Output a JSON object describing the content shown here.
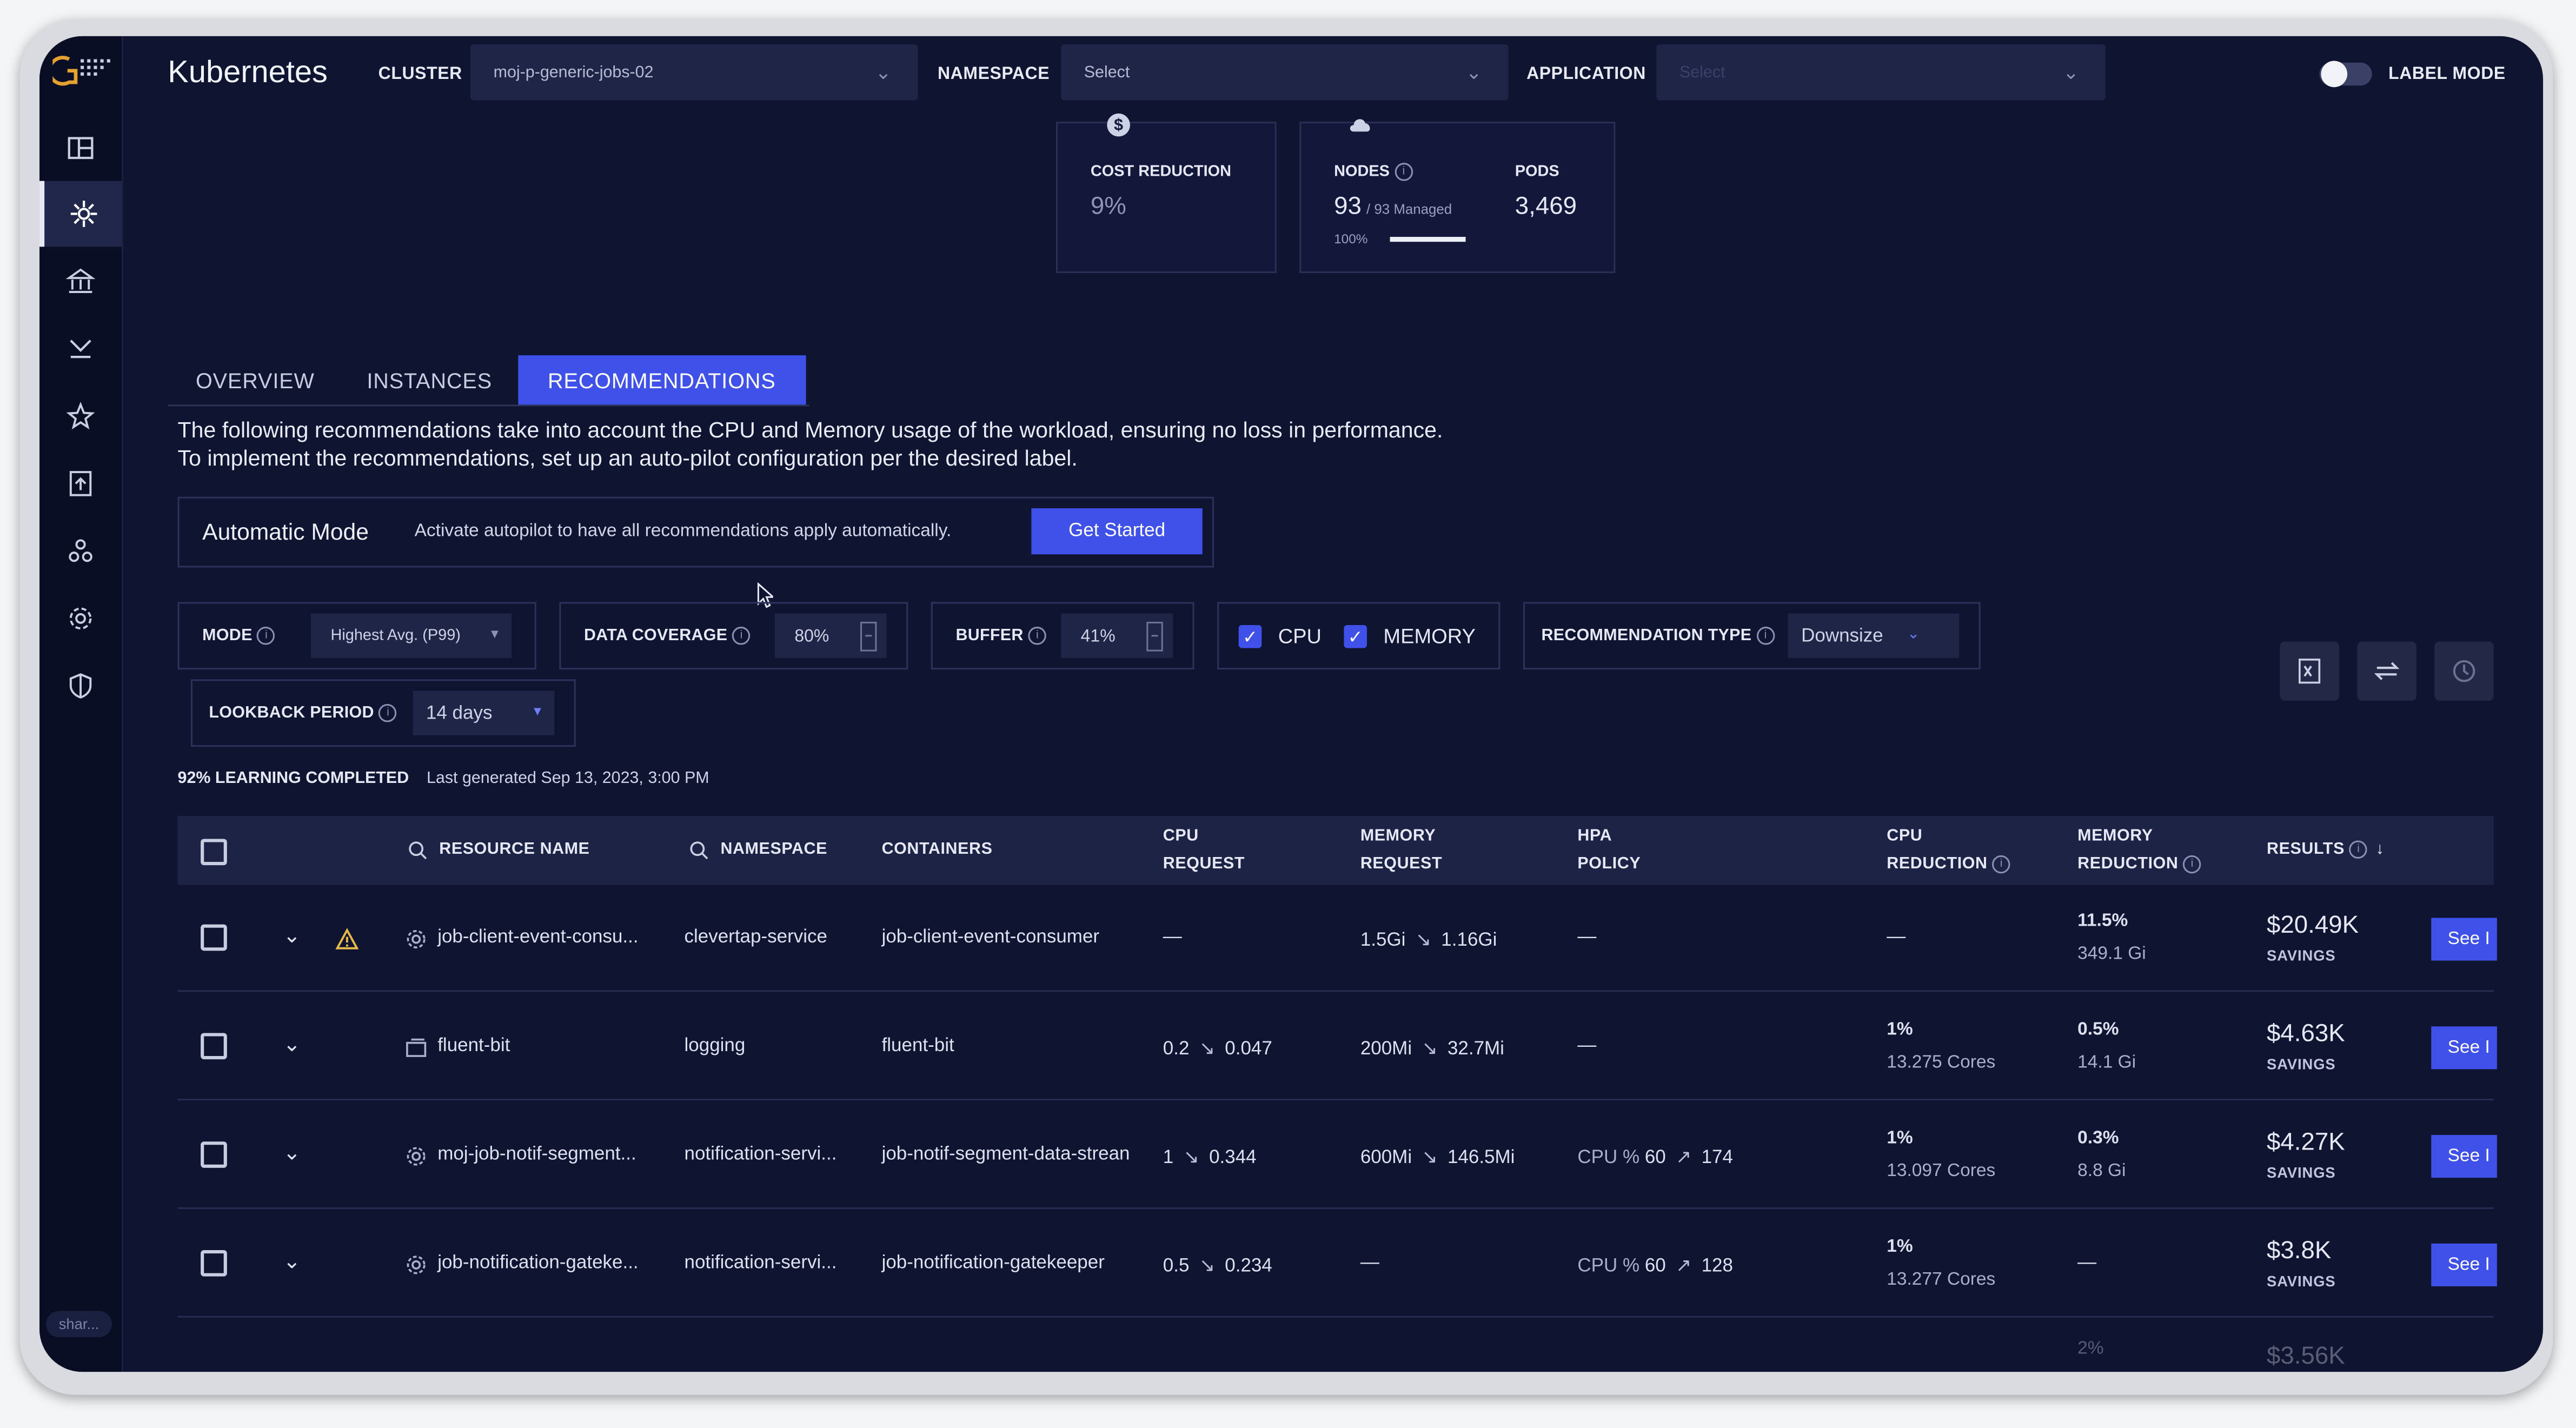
{
  "header": {
    "app_title": "Kubernetes",
    "cluster_label": "CLUSTER",
    "cluster_value": "moj-p-generic-jobs-02",
    "namespace_label": "NAMESPACE",
    "namespace_value": "Select",
    "application_label": "APPLICATION",
    "application_value": "Select",
    "label_mode": "LABEL MODE"
  },
  "sidebar": {
    "share_chip": "shar..."
  },
  "metrics": {
    "cost_reduction_label": "COST REDUCTION",
    "cost_reduction_value": "9%",
    "nodes_label": "NODES",
    "nodes_value": "93",
    "nodes_managed": "/ 93 Managed",
    "nodes_percent_label": "100%",
    "nodes_managed_fraction": 1.0,
    "pods_label": "PODS",
    "pods_value": "3,469"
  },
  "tabs": [
    {
      "label": "OVERVIEW"
    },
    {
      "label": "INSTANCES"
    },
    {
      "label": "RECOMMENDATIONS"
    }
  ],
  "description": {
    "line1": "The following recommendations take into account the CPU and Memory usage of the workload, ensuring no loss in performance.",
    "line2": "To implement the recommendations, set up an auto-pilot configuration per the desired label."
  },
  "automatic_mode": {
    "title": "Automatic Mode",
    "text": "Activate autopilot to have all recommendations apply automatically.",
    "button": "Get Started"
  },
  "filters": {
    "mode_label": "MODE",
    "mode_value": "Highest Avg. (P99)",
    "data_coverage_label": "DATA COVERAGE",
    "data_coverage_value": "80%",
    "buffer_label": "BUFFER",
    "buffer_value": "41%",
    "cpu_label": "CPU",
    "memory_label": "MEMORY",
    "recommendation_type_label": "RECOMMENDATION TYPE",
    "recommendation_type_value": "Downsize",
    "lookback_label": "LOOKBACK PERIOD",
    "lookback_value": "14 days"
  },
  "status": {
    "learning": "92% LEARNING COMPLETED",
    "generated": "Last generated Sep 13, 2023, 3:00 PM"
  },
  "table": {
    "headers": {
      "resource_name": "RESOURCE NAME",
      "namespace": "NAMESPACE",
      "containers": "CONTAINERS",
      "cpu_request_1": "CPU",
      "cpu_request_2": "REQUEST",
      "memory_request_1": "MEMORY",
      "memory_request_2": "REQUEST",
      "hpa_1": "HPA",
      "hpa_2": "POLICY",
      "cpu_reduction_1": "CPU",
      "cpu_reduction_2": "REDUCTION",
      "memory_reduction_1": "MEMORY",
      "memory_reduction_2": "REDUCTION",
      "results": "RESULTS"
    },
    "rows": [
      {
        "name": "job-client-event-consu...",
        "namespace": "clevertap-service",
        "container": "job-client-event-consumer",
        "cpu_from": "—",
        "cpu_to": "",
        "mem_from": "1.5Gi",
        "mem_to": "1.16Gi",
        "hpa": "—",
        "hpa_val": "",
        "hpa_to": "",
        "cpu_red_pct": "—",
        "cpu_red_abs": "",
        "mem_red_pct": "11.5%",
        "mem_red_abs": "349.1 Gi",
        "savings": "$20.49K",
        "savings_label": "SAVINGS",
        "button": "See I"
      },
      {
        "name": "fluent-bit",
        "namespace": "logging",
        "container": "fluent-bit",
        "cpu_from": "0.2",
        "cpu_to": "0.047",
        "mem_from": "200Mi",
        "mem_to": "32.7Mi",
        "hpa": "—",
        "hpa_val": "",
        "hpa_to": "",
        "cpu_red_pct": "1%",
        "cpu_red_abs": "13.275 Cores",
        "mem_red_pct": "0.5%",
        "mem_red_abs": "14.1 Gi",
        "savings": "$4.63K",
        "savings_label": "SAVINGS",
        "button": "See I"
      },
      {
        "name": "moj-job-notif-segment...",
        "namespace": "notification-servi...",
        "container": "job-notif-segment-data-strean",
        "cpu_from": "1",
        "cpu_to": "0.344",
        "mem_from": "600Mi",
        "mem_to": "146.5Mi",
        "hpa": "CPU %",
        "hpa_val": "60",
        "hpa_to": "174",
        "cpu_red_pct": "1%",
        "cpu_red_abs": "13.097 Cores",
        "mem_red_pct": "0.3%",
        "mem_red_abs": "8.8 Gi",
        "savings": "$4.27K",
        "savings_label": "SAVINGS",
        "button": "See I"
      },
      {
        "name": "job-notification-gateke...",
        "namespace": "notification-servi...",
        "container": "job-notification-gatekeeper",
        "cpu_from": "0.5",
        "cpu_to": "0.234",
        "mem_from": "—",
        "mem_to": "",
        "hpa": "CPU %",
        "hpa_val": "60",
        "hpa_to": "128",
        "cpu_red_pct": "1%",
        "cpu_red_abs": "13.277 Cores",
        "mem_red_pct": "—",
        "mem_red_abs": "",
        "savings": "$3.8K",
        "savings_label": "SAVINGS",
        "button": "See I"
      }
    ],
    "partial_row": {
      "mem_red_pct": "2%",
      "savings": "$3.56K"
    }
  }
}
